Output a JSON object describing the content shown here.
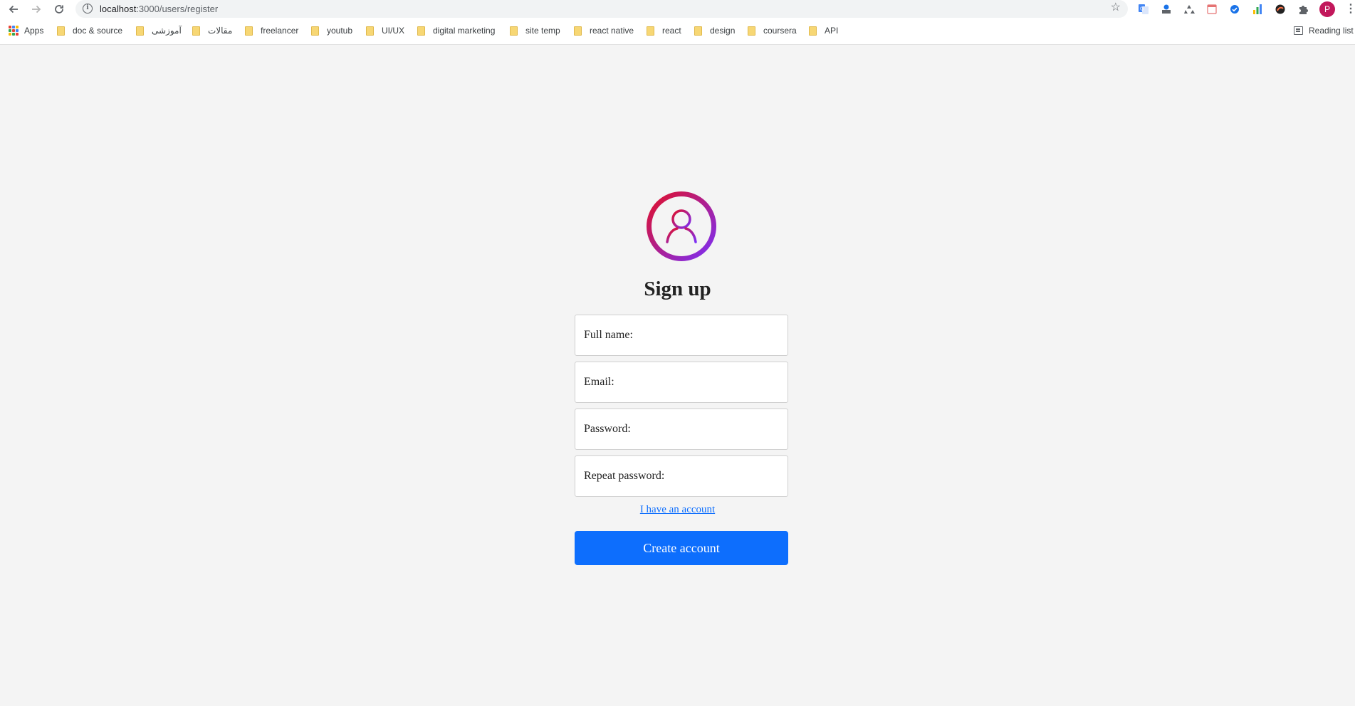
{
  "browser": {
    "url_host": "localhost",
    "url_path": ":3000/users/register",
    "profile_initial": "P",
    "bookmarks": {
      "apps": "Apps",
      "items": [
        "doc & source",
        "آموزشی",
        "مقالات",
        "freelancer",
        "youtub",
        "UI/UX",
        "digital marketing",
        "site temp",
        "react native",
        "react",
        "design",
        "coursera",
        "API"
      ],
      "reading_list": "Reading list"
    }
  },
  "signup": {
    "title": "Sign up",
    "fields": {
      "full_name_label": "Full name:",
      "email_label": "Email:",
      "password_label": "Password:",
      "repeat_password_label": "Repeat password:"
    },
    "account_link": "I have an account",
    "submit_label": "Create account"
  },
  "colors": {
    "accent": "#0d6efd",
    "avatar_gradient_start": "#e0102a",
    "avatar_gradient_end": "#7b2ff7",
    "page_background": "#f4f4f4"
  }
}
